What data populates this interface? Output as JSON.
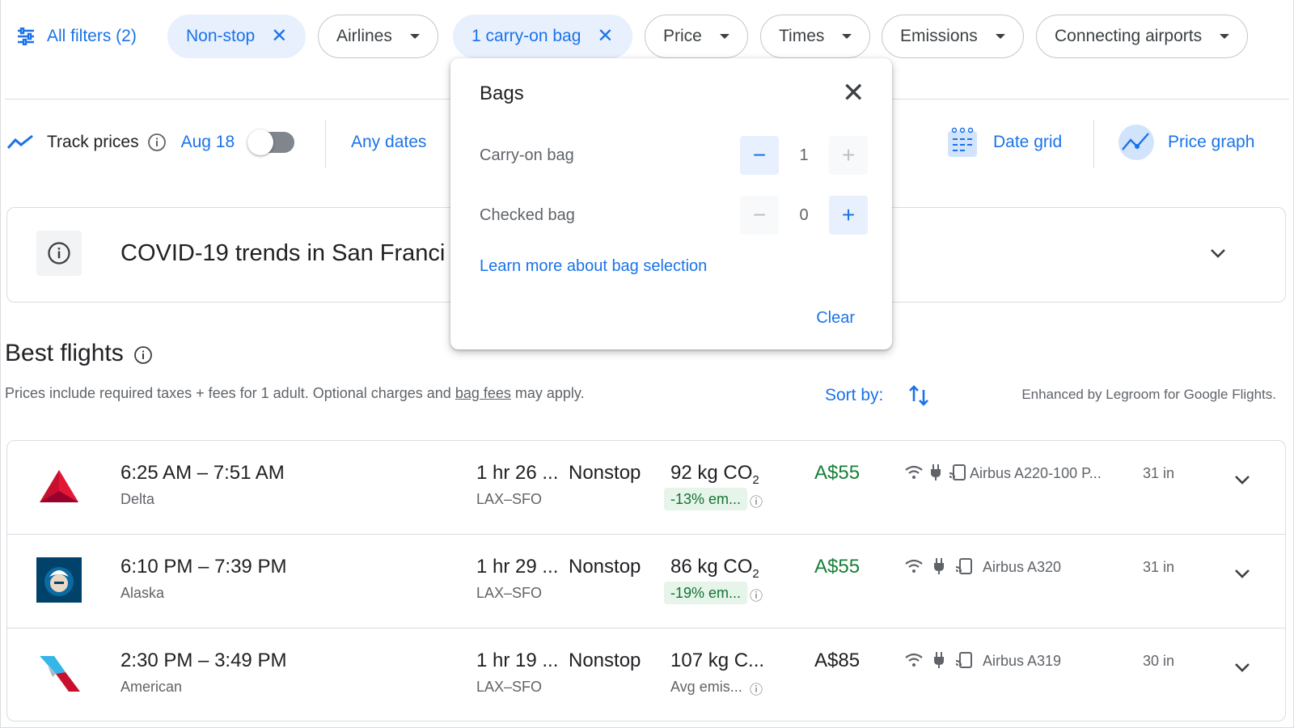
{
  "filters": {
    "all_filters": "All filters (2)",
    "chips": [
      {
        "label": "Non-stop",
        "active": true
      },
      {
        "label": "Airlines",
        "active": false
      },
      {
        "label": "1 carry-on bag",
        "active": true
      },
      {
        "label": "Price",
        "active": false
      },
      {
        "label": "Times",
        "active": false
      },
      {
        "label": "Emissions",
        "active": false
      },
      {
        "label": "Connecting airports",
        "active": false
      }
    ]
  },
  "toolbar": {
    "track_prices": "Track prices",
    "date": "Aug 18",
    "any_dates": "Any dates",
    "date_grid": "Date grid",
    "price_graph": "Price graph"
  },
  "covid": {
    "title": "COVID-19 trends in San Franci"
  },
  "bags_popup": {
    "title": "Bags",
    "carry_on_label": "Carry-on bag",
    "carry_on_value": "1",
    "checked_label": "Checked bag",
    "checked_value": "0",
    "learn_more": "Learn more about bag selection",
    "clear": "Clear"
  },
  "results": {
    "heading": "Best flights",
    "subtext_before": "Prices include required taxes + fees for 1 adult. Optional charges and ",
    "subtext_link": "bag fees",
    "subtext_after": " may apply.",
    "sort_by": "Sort by:",
    "enhanced": "Enhanced by Legroom for Google Flights."
  },
  "flights": [
    {
      "times": "6:25 AM – 7:51 AM",
      "airline": "Delta",
      "duration": "1 hr 26 ...",
      "route": "LAX–SFO",
      "stops": "Nonstop",
      "co2": "92 kg CO",
      "co2_sub": "2",
      "emissions": "-13% em...",
      "price": "A$55",
      "aircraft": "Airbus A220-100 P...",
      "legroom": "31 in"
    },
    {
      "times": "6:10 PM – 7:39 PM",
      "airline": "Alaska",
      "duration": "1 hr 29 ...",
      "route": "LAX–SFO",
      "stops": "Nonstop",
      "co2": "86 kg CO",
      "co2_sub": "2",
      "emissions": "-19% em...",
      "price": "A$55",
      "aircraft": "Airbus A320",
      "legroom": "31 in"
    },
    {
      "times": "2:30 PM – 3:49 PM",
      "airline": "American",
      "duration": "1 hr 19 ...",
      "route": "LAX–SFO",
      "stops": "Nonstop",
      "co2": "107 kg C...",
      "co2_sub": "",
      "emissions": "Avg emis...",
      "price": "A$85",
      "aircraft": "Airbus A319",
      "legroom": "30 in"
    }
  ],
  "colors": {
    "accent": "#1a73e8",
    "chip_active_bg": "#e8f0fe",
    "price_green": "#188038",
    "emission_bg": "#e6f4ea"
  }
}
